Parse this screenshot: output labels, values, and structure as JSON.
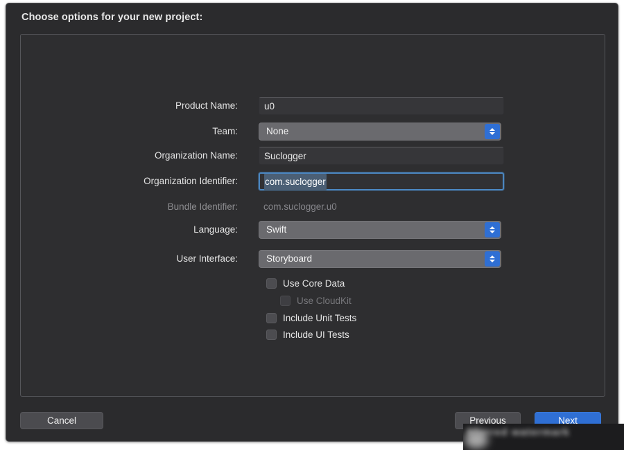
{
  "dialog": {
    "title": "Choose options for your new project:"
  },
  "form": {
    "fields": [
      {
        "label": "Product Name:",
        "value": "u0",
        "type": "text"
      },
      {
        "label": "Team:",
        "value": "None",
        "type": "popup"
      },
      {
        "label": "Organization Name:",
        "value": "Suclogger",
        "type": "text"
      },
      {
        "label": "Organization Identifier:",
        "value": "com.suclogger",
        "type": "text-focused"
      },
      {
        "label": "Bundle Identifier:",
        "value": "com.suclogger.u0",
        "type": "static"
      },
      {
        "label": "Language:",
        "value": "Swift",
        "type": "popup"
      },
      {
        "label": "User Interface:",
        "value": "Storyboard",
        "type": "popup"
      }
    ],
    "checkboxes": [
      {
        "label": "Use Core Data",
        "checked": false,
        "disabled": false,
        "indented": false
      },
      {
        "label": "Use CloudKit",
        "checked": false,
        "disabled": true,
        "indented": true
      },
      {
        "label": "Include Unit Tests",
        "checked": false,
        "disabled": false,
        "indented": false
      },
      {
        "label": "Include UI Tests",
        "checked": false,
        "disabled": false,
        "indented": false
      }
    ]
  },
  "footer": {
    "cancel_label": "Cancel",
    "previous_label": "Previous",
    "next_label": "Next"
  },
  "watermark": {
    "text": "blurred watermark"
  },
  "colors": {
    "window_background": "#2b2b2d",
    "panel_background": "#2e2e30",
    "accent_blue": "#2f6fd4",
    "focus_ring": "#4b86c0",
    "selection": "#4b5f75",
    "popup_background": "#6a6a6e",
    "text_primary": "#e6e6e6",
    "text_disabled": "#85858a"
  }
}
